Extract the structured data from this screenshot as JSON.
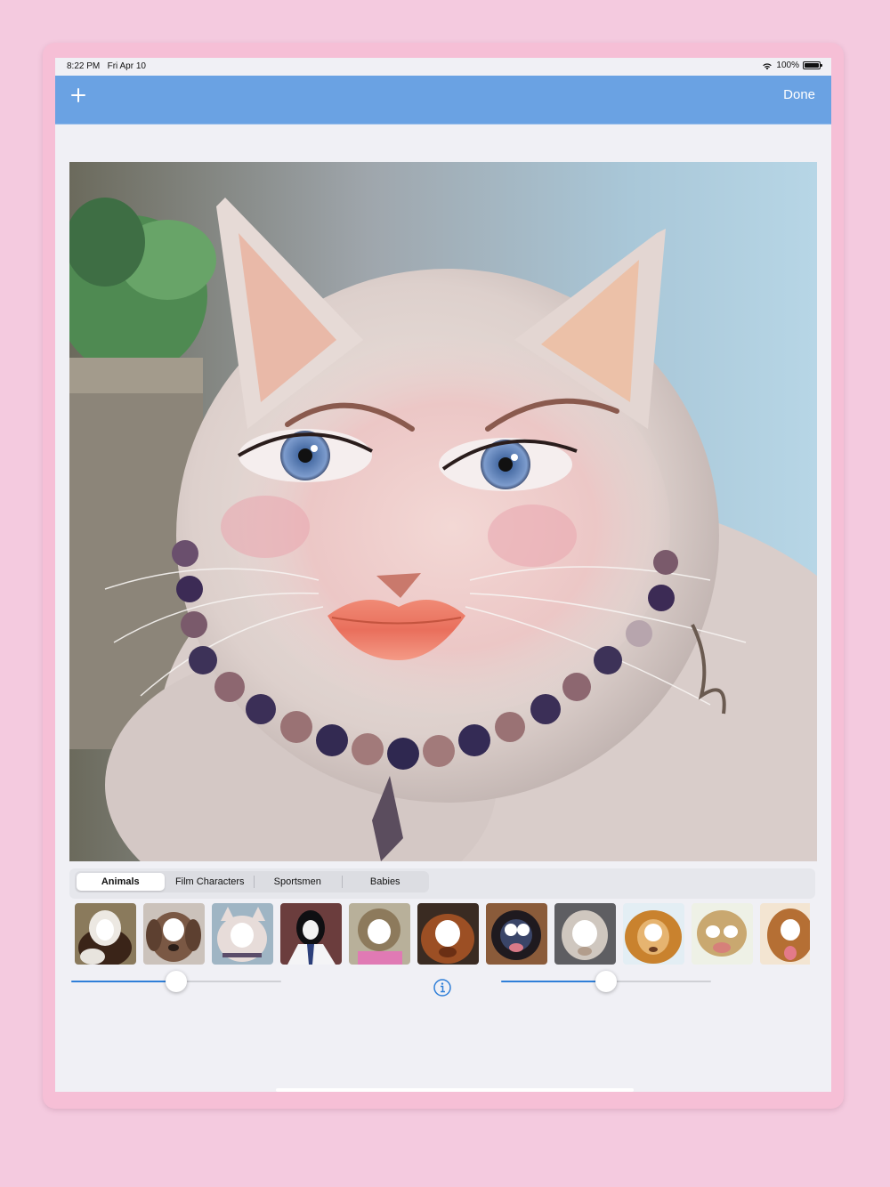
{
  "status_bar": {
    "time": "8:22 PM",
    "date": "Fri Apr 10",
    "battery": "100%"
  },
  "nav": {
    "add_icon": "plus-icon",
    "done_label": "Done",
    "color": "#6aa2e3"
  },
  "categories": {
    "tabs": [
      "Animals",
      "Film Characters",
      "Sportsmen",
      "Babies"
    ],
    "selected": "Animals"
  },
  "thumbnails": [
    "lemur",
    "dog",
    "cat",
    "penguin",
    "monkey",
    "orangutan",
    "baby-chimp",
    "macaque",
    "lion",
    "monkey",
    "dog"
  ],
  "sliders": {
    "left_value": 0.5,
    "right_value": 0.5
  },
  "info_icon": "info-icon",
  "accent_color": "#2f7fd8"
}
